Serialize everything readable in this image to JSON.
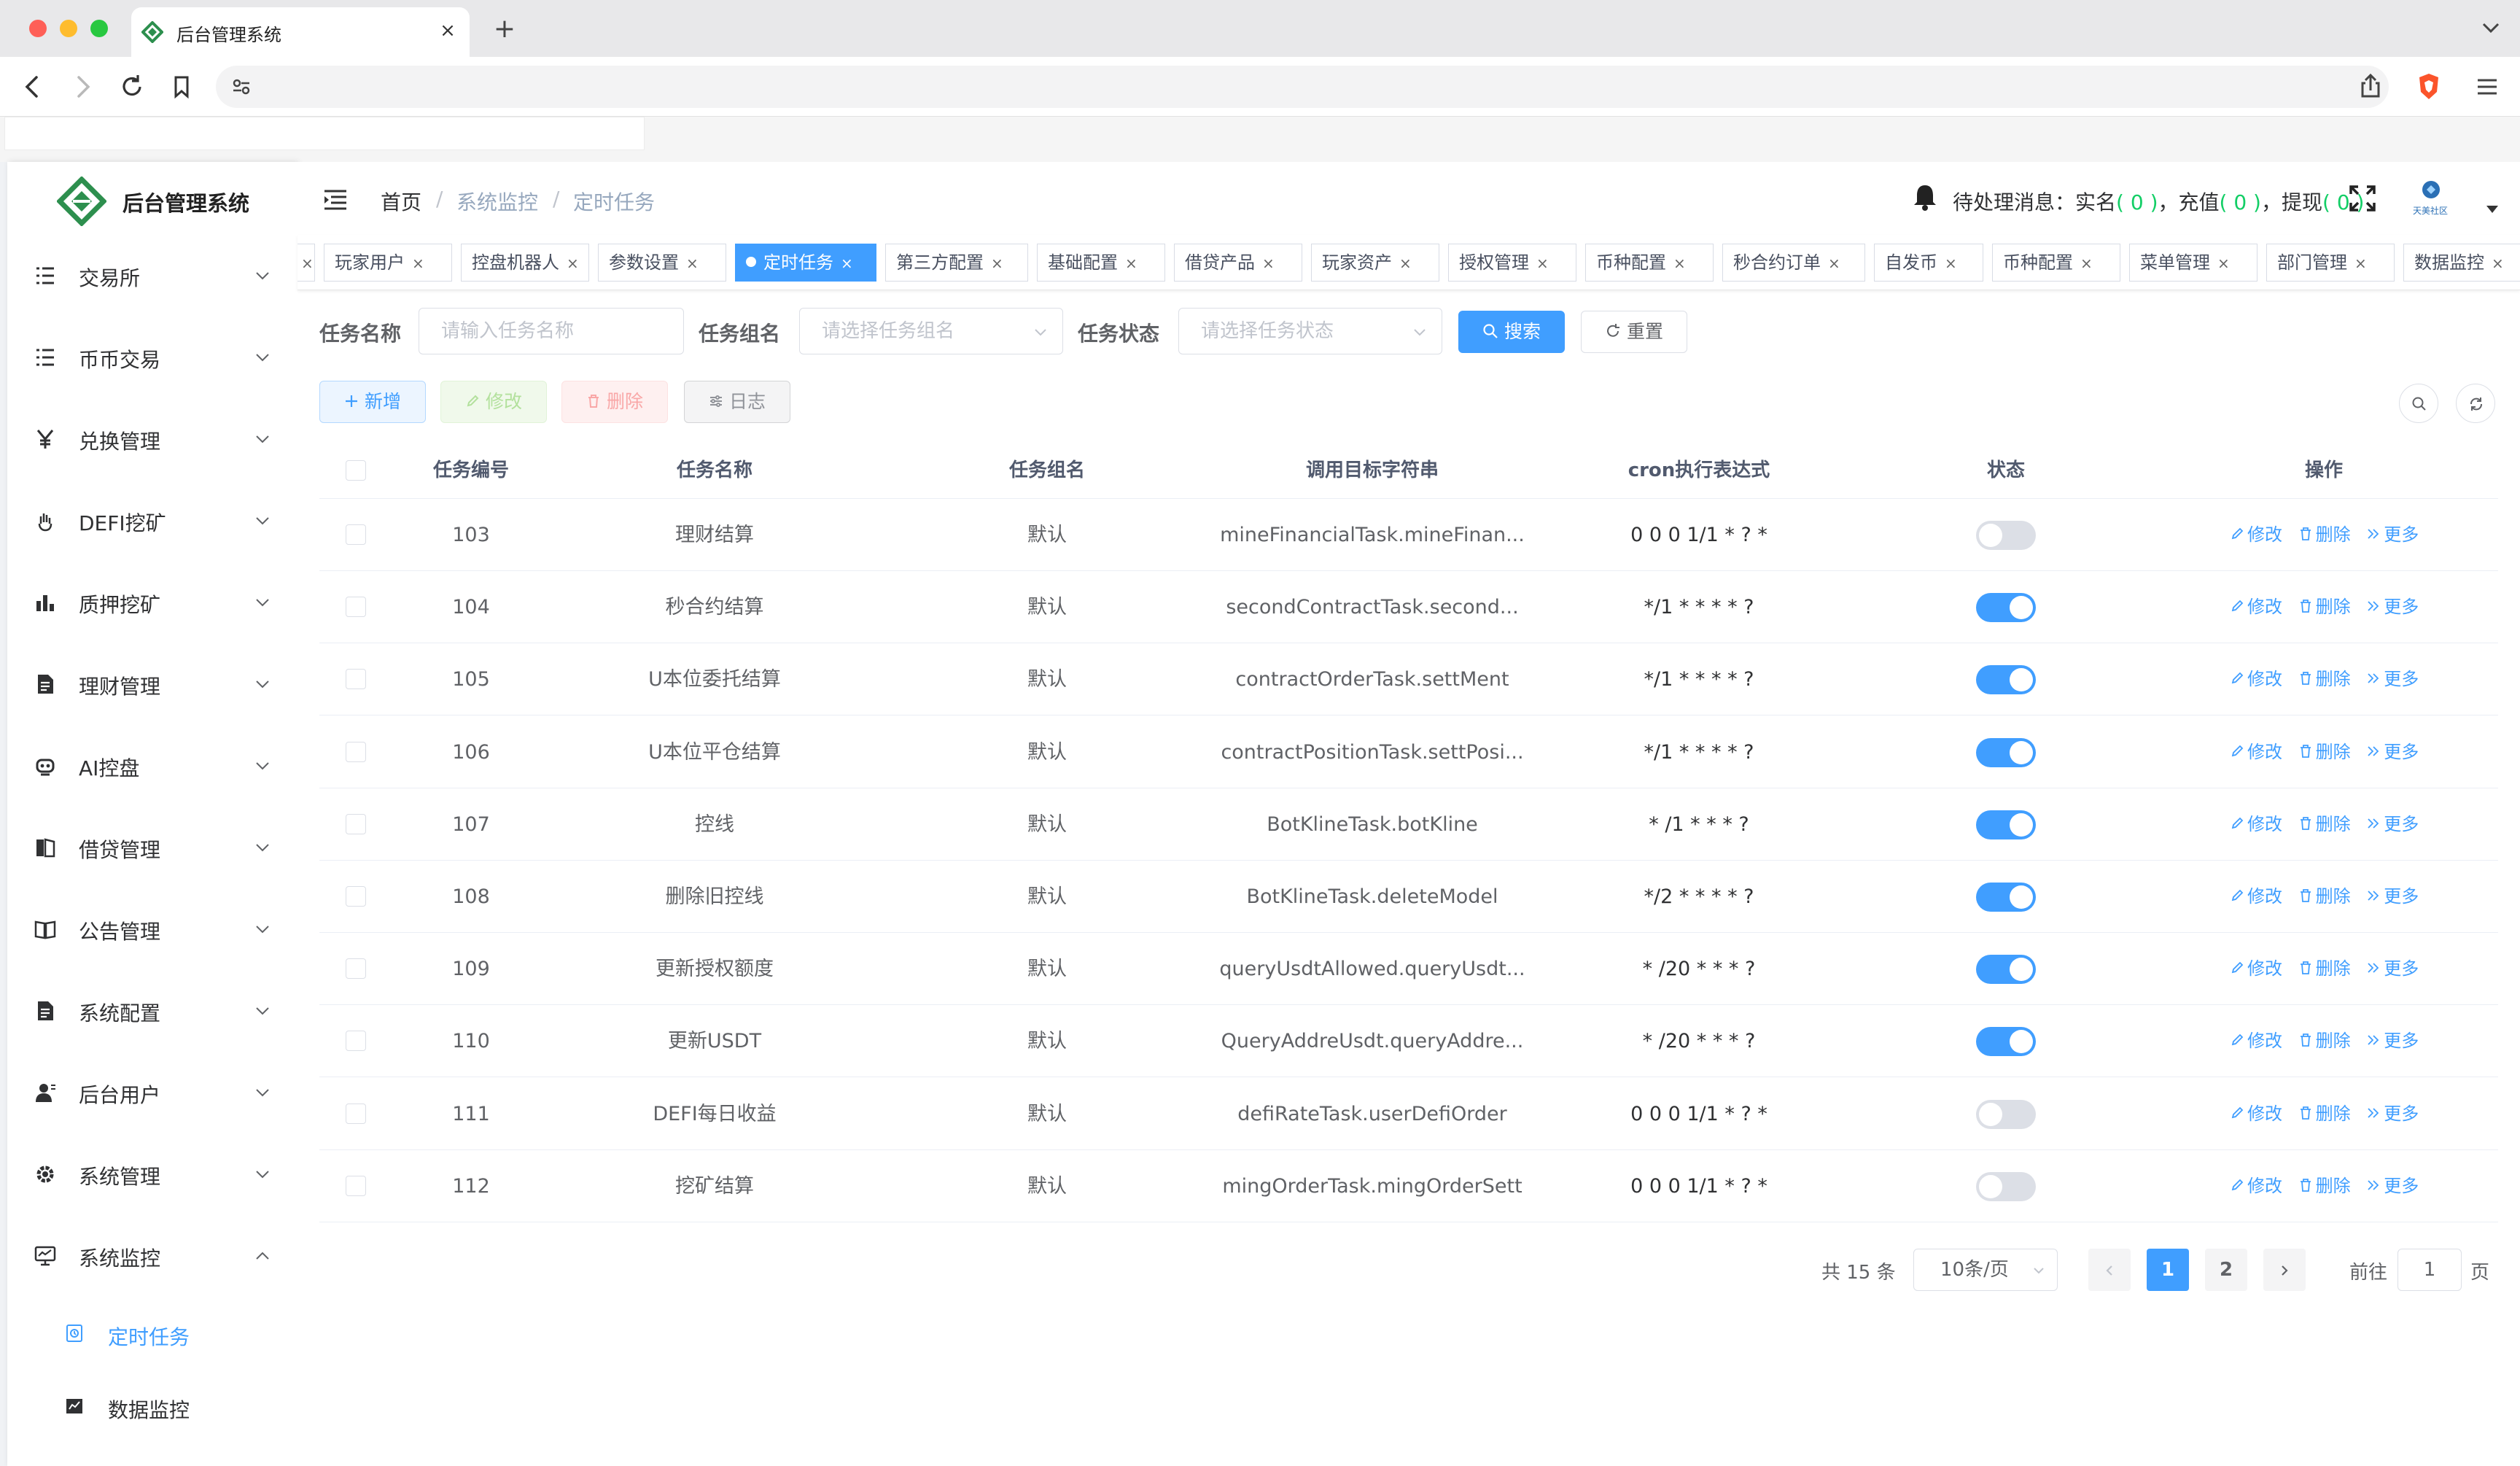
{
  "browser": {
    "tab_title": "后台管理系统",
    "new_tab": "+",
    "tab_close": "×"
  },
  "app": {
    "title": "后台管理系统"
  },
  "sidebar": {
    "items": [
      {
        "label": "交易所",
        "icon": "list-icon"
      },
      {
        "label": "币币交易",
        "icon": "list-icon"
      },
      {
        "label": "兑换管理",
        "icon": "yen-icon"
      },
      {
        "label": "DEFI挖矿",
        "icon": "hand-icon"
      },
      {
        "label": "质押挖矿",
        "icon": "bar-chart-icon"
      },
      {
        "label": "理财管理",
        "icon": "document-icon"
      },
      {
        "label": "AI控盘",
        "icon": "robot-icon"
      },
      {
        "label": "借贷管理",
        "icon": "book-icon"
      },
      {
        "label": "公告管理",
        "icon": "open-book-icon"
      },
      {
        "label": "系统配置",
        "icon": "document-icon"
      },
      {
        "label": "后台用户",
        "icon": "user-icon"
      },
      {
        "label": "系统管理",
        "icon": "gear-icon"
      },
      {
        "label": "系统监控",
        "icon": "monitor-icon"
      }
    ],
    "sub_items": [
      {
        "label": "定时任务",
        "icon": "job-icon",
        "active": true
      },
      {
        "label": "数据监控",
        "icon": "chart-icon",
        "active": false
      }
    ]
  },
  "navbar": {
    "breadcrumb": [
      "首页",
      "系统监控",
      "定时任务"
    ],
    "crumb_sep": "/",
    "pending_label": "待处理消息：",
    "pending_realname": "实名",
    "pending_realname_count": "( 0 )",
    "pending_recharge": "，充值",
    "pending_recharge_count": "( 0 )",
    "pending_withdraw": "，提现",
    "pending_withdraw_count": "( 0 )",
    "avatar_text": "天美社区"
  },
  "tags": [
    {
      "label": "",
      "active": false
    },
    {
      "label": "玩家用户",
      "active": false
    },
    {
      "label": "控盘机器人",
      "active": false
    },
    {
      "label": "参数设置",
      "active": false
    },
    {
      "label": "定时任务",
      "active": true
    },
    {
      "label": "第三方配置",
      "active": false
    },
    {
      "label": "基础配置",
      "active": false
    },
    {
      "label": "借贷产品",
      "active": false
    },
    {
      "label": "玩家资产",
      "active": false
    },
    {
      "label": "授权管理",
      "active": false
    },
    {
      "label": "币种配置",
      "active": false
    },
    {
      "label": "秒合约订单",
      "active": false
    },
    {
      "label": "自发币",
      "active": false
    },
    {
      "label": "币种配置",
      "active": false
    },
    {
      "label": "菜单管理",
      "active": false
    },
    {
      "label": "部门管理",
      "active": false
    },
    {
      "label": "数据监控",
      "active": false
    }
  ],
  "search_form": {
    "job_name_label": "任务名称",
    "job_name_placeholder": "请输入任务名称",
    "job_group_label": "任务组名",
    "job_group_placeholder": "请选择任务组名",
    "job_status_label": "任务状态",
    "job_status_placeholder": "请选择任务状态",
    "search_label": "搜索",
    "reset_label": "重置"
  },
  "actions": {
    "add": "新增",
    "edit": "修改",
    "delete": "删除",
    "log": "日志"
  },
  "table": {
    "columns": [
      "任务编号",
      "任务名称",
      "任务组名",
      "调用目标字符串",
      "cron执行表达式",
      "状态",
      "操作"
    ],
    "ops": [
      "修改",
      "删除",
      "更多"
    ],
    "rows": [
      {
        "id": "103",
        "name": "理财结算",
        "group": "默认",
        "target": "mineFinancialTask.mineFinan...",
        "cron": "0 0 0 1/1 * ? *",
        "status": 0
      },
      {
        "id": "104",
        "name": "秒合约结算",
        "group": "默认",
        "target": "secondContractTask.second...",
        "cron": "*/1 * * * * ?",
        "status": 1
      },
      {
        "id": "105",
        "name": "U本位委托结算",
        "group": "默认",
        "target": "contractOrderTask.settMent",
        "cron": "*/1 * * * * ?",
        "status": 1
      },
      {
        "id": "106",
        "name": "U本位平仓结算",
        "group": "默认",
        "target": "contractPositionTask.settPosi...",
        "cron": "*/1 * * * * ?",
        "status": 1
      },
      {
        "id": "107",
        "name": "控线",
        "group": "默认",
        "target": "BotKlineTask.botKline",
        "cron": "* /1 * * * ?",
        "status": 1
      },
      {
        "id": "108",
        "name": "删除旧控线",
        "group": "默认",
        "target": "BotKlineTask.deleteModel",
        "cron": "*/2 * * * * ?",
        "status": 1
      },
      {
        "id": "109",
        "name": "更新授权额度",
        "group": "默认",
        "target": "queryUsdtAllowed.queryUsdt...",
        "cron": "* /20 * * * ?",
        "status": 1
      },
      {
        "id": "110",
        "name": "更新USDT",
        "group": "默认",
        "target": "QueryAddreUsdt.queryAddre...",
        "cron": "* /20 * * * ?",
        "status": 1
      },
      {
        "id": "111",
        "name": "DEFI每日收益",
        "group": "默认",
        "target": "defiRateTask.userDefiOrder",
        "cron": "0 0 0 1/1 * ? *",
        "status": 0
      },
      {
        "id": "112",
        "name": "挖矿结算",
        "group": "默认",
        "target": "mingOrderTask.mingOrderSett",
        "cron": "0 0 0 1/1 * ? *",
        "status": 0
      }
    ]
  },
  "pagination": {
    "total": "共 15 条",
    "page_size": "10条/页",
    "pages": [
      "1",
      "2"
    ],
    "current": "1",
    "goto_label": "前往",
    "goto_value": "1",
    "goto_unit": "页"
  },
  "colors": {
    "primary": "#409eff",
    "success": "#13ce66",
    "switch_off": "#dcdfe6"
  }
}
